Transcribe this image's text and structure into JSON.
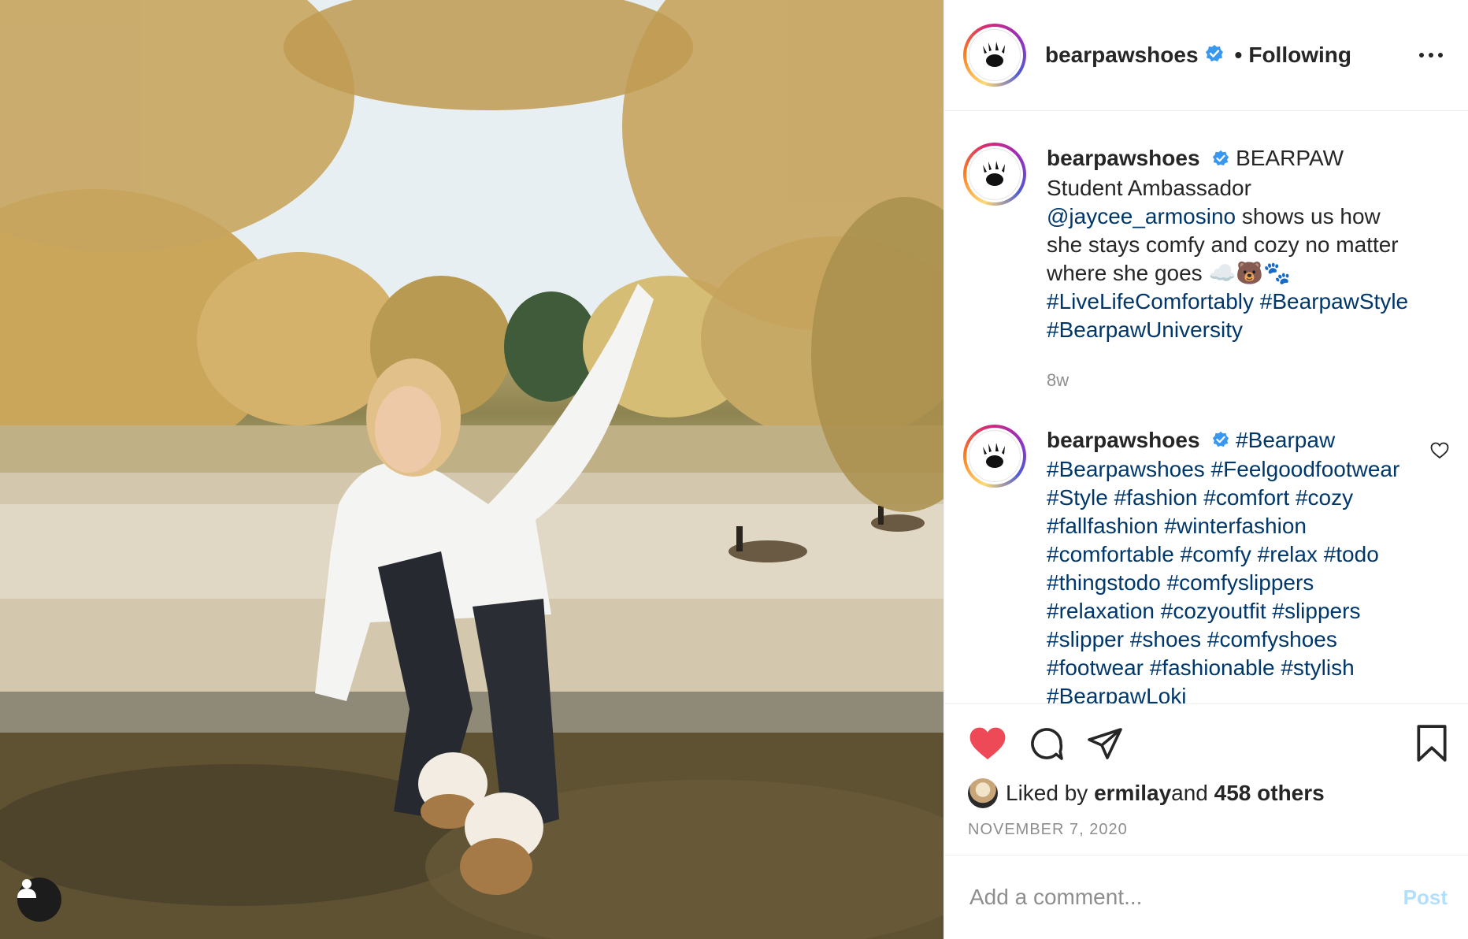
{
  "account": {
    "username": "bearpawshoes",
    "separator": "•",
    "follow_state": "Following",
    "avatar_icon": "bear-paw-logo-icon"
  },
  "photo": {
    "description_icon": "photo-content",
    "tag_icon": "user-tag-icon"
  },
  "caption": {
    "username": "bearpawshoes",
    "text_before": "BEARPAW Student Ambassador ",
    "mention": "@jaycee_armosino",
    "text_after": " shows us how she stays comfy and cozy no matter where she goes ☁️🐻🐾",
    "hashtags": "#LiveLifeComfortably #BearpawStyle #BearpawUniversity",
    "age": "8w"
  },
  "comment": {
    "username": "bearpawshoes",
    "text": "#Bearpaw #Bearpawshoes #Feelgoodfootwear #Style #fashion #comfort #cozy #fallfashion #winterfashion #comfortable #comfy #relax #todo #thingstodo #comfyslippers #relaxation #cozyoutfit #slippers #slipper #shoes #comfyshoes #footwear #fashionable #stylish #BearpawLoki",
    "like_icon": "heart-outline-icon"
  },
  "actions": {
    "like_icon": "heart-filled-icon",
    "comment_icon": "comment-bubble-icon",
    "share_icon": "paper-plane-icon",
    "save_icon": "bookmark-icon"
  },
  "likes": {
    "prefix": "Liked by ",
    "user": "ermilay",
    "middle": " and ",
    "count": "458 others"
  },
  "date": "NOVEMBER 7, 2020",
  "comment_input": {
    "placeholder": "Add a comment...",
    "post_label": "Post"
  },
  "colors": {
    "like_red": "#ed4956",
    "link_blue": "#00376b",
    "verified_blue": "#3897f0",
    "post_disabled": "#b2dffc",
    "meta_gray": "#8e8e8e"
  }
}
